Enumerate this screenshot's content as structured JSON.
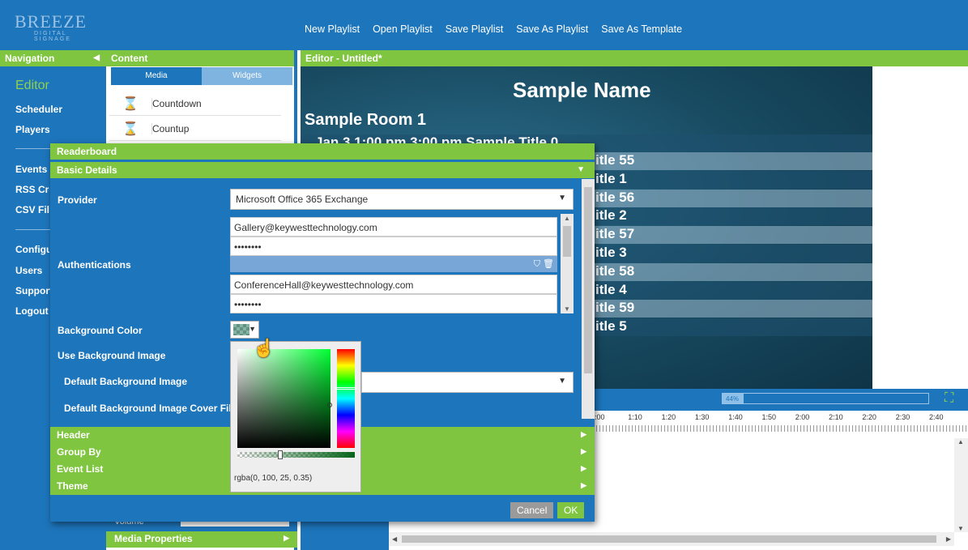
{
  "brand": {
    "name": "BREEZE",
    "tagline": "DIGITAL SIGNAGE"
  },
  "menu": [
    "New Playlist",
    "Open Playlist",
    "Save Playlist",
    "Save As Playlist",
    "Save As Template"
  ],
  "nav": {
    "header": "Navigation",
    "items": [
      "Editor",
      "Scheduler",
      "Players",
      "Events",
      "RSS Crea",
      "CSV File",
      "Configur",
      "Users",
      "Support",
      "Logout"
    ]
  },
  "content": {
    "header": "Content",
    "tabs": [
      "Media",
      "Widgets"
    ],
    "widgets": [
      "Countdown",
      "Countup"
    ],
    "volume_label": "Volume",
    "media_properties": "Media Properties"
  },
  "editor": {
    "header": "Editor - Untitled*",
    "preview": {
      "title": "Sample Name",
      "room": "Sample Room 1",
      "first_row": "Jan 3   1:00 pm       3:00 pm   Sample Title 0",
      "rows": [
        "itle 0",
        "itle 55",
        "itle 1",
        "itle 56",
        "itle 2",
        "itle 57",
        "itle 3",
        "itle 58",
        "itle 4",
        "itle 59",
        "itle 5"
      ]
    },
    "zoom": "44%",
    "zoom_fraction": 0.44,
    "timeline": [
      ":00",
      "1:10",
      "1:20",
      "1:30",
      "1:40",
      "1:50",
      "2:00",
      "2:10",
      "2:20",
      "2:30",
      "2:40"
    ]
  },
  "dialog": {
    "title": "Readerboard",
    "section": "Basic Details",
    "labels": {
      "provider": "Provider",
      "auth": "Authentications",
      "bg_color": "Background Color",
      "use_bg_image": "Use Background Image",
      "default_bg_image": "Default Background Image",
      "default_bg_cover": "Default Background Image Cover Fill"
    },
    "provider_value": "Microsoft Office 365 Exchange",
    "accounts": [
      {
        "email": "Gallery@keywesttechnology.com",
        "password": "••••••••"
      },
      {
        "email": "ConferenceHall@keywesttechnology.com",
        "password": "••••••••"
      }
    ],
    "color_value": "rgba(0, 100, 25, 0.35)",
    "collapsed": [
      "Header",
      "Group By",
      "Event List",
      "Theme"
    ],
    "cancel": "Cancel",
    "ok": "OK"
  },
  "colors": {
    "primary_blue": "#1d75bb",
    "accent_green": "#7fc540"
  }
}
